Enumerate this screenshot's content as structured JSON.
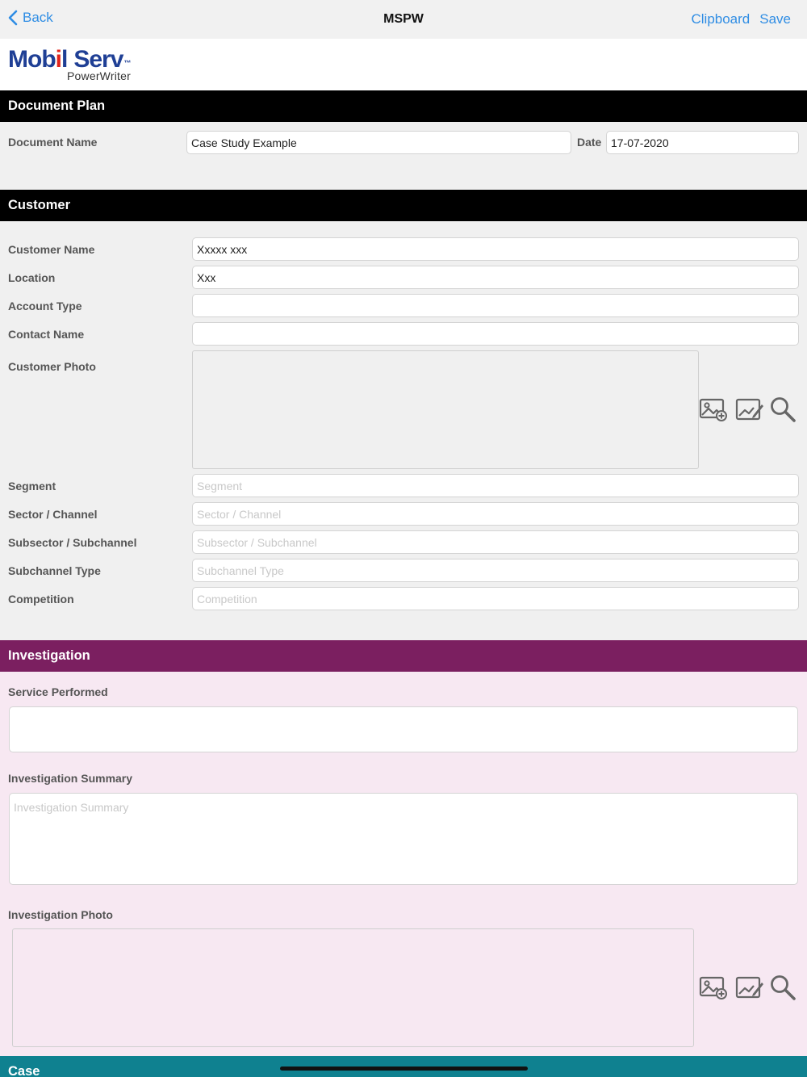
{
  "nav": {
    "back_label": "Back",
    "title": "MSPW",
    "clipboard_label": "Clipboard",
    "save_label": "Save"
  },
  "logo": {
    "mob": "Mob",
    "o_letter": "i",
    "l_letter": "l",
    "serv": "Serv",
    "tm": "™",
    "sub": "PowerWriter"
  },
  "document_plan": {
    "header": "Document Plan",
    "name_label": "Document Name",
    "name_value": "Case Study Example",
    "date_label": "Date",
    "date_value": "17-07-2020"
  },
  "customer": {
    "header": "Customer",
    "fields": [
      {
        "label": "Customer Name",
        "value": "Xxxxx xxx",
        "placeholder": ""
      },
      {
        "label": "Location",
        "value": "Xxx",
        "placeholder": ""
      },
      {
        "label": "Account Type",
        "value": "",
        "placeholder": ""
      },
      {
        "label": "Contact Name",
        "value": "",
        "placeholder": ""
      }
    ],
    "photo_label": "Customer Photo",
    "extra_fields": [
      {
        "label": "Segment",
        "value": "",
        "placeholder": "Segment"
      },
      {
        "label": "Sector / Channel",
        "value": "",
        "placeholder": "Sector / Channel"
      },
      {
        "label": "Subsector / Subchannel",
        "value": "",
        "placeholder": "Subsector / Subchannel"
      },
      {
        "label": "Subchannel Type",
        "value": "",
        "placeholder": "Subchannel Type"
      },
      {
        "label": "Competition",
        "value": "",
        "placeholder": "Competition"
      }
    ]
  },
  "investigation": {
    "header": "Investigation",
    "service_label": "Service Performed",
    "service_value": "",
    "summary_label": "Investigation Summary",
    "summary_placeholder": "Investigation Summary",
    "photo_label": "Investigation Photo"
  },
  "case": {
    "header": "Case"
  },
  "icons": {
    "add_photo": "add-photo-icon",
    "edit_photo": "edit-photo-icon",
    "magnify": "magnifier-icon"
  },
  "colors": {
    "accent": "#2f8de4",
    "section_black": "#000000",
    "section_purple": "#7b1f60",
    "section_teal": "#0f8190",
    "panel_pink": "#f7e8f2",
    "panel_grey": "#f0f0f0"
  }
}
